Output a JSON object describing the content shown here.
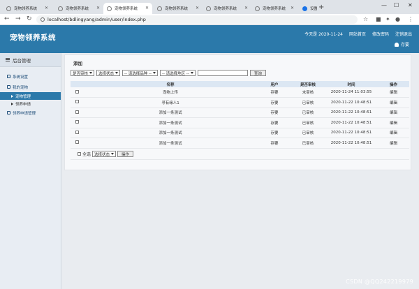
{
  "browser": {
    "tabs": [
      {
        "label": "宠物领养系统",
        "active": false
      },
      {
        "label": "宠物领养系统",
        "active": false
      },
      {
        "label": "宠物领养系统",
        "active": true
      },
      {
        "label": "宠物领养系统",
        "active": false
      },
      {
        "label": "宠物领养系统",
        "active": false
      },
      {
        "label": "宠物领养系统",
        "active": false
      },
      {
        "label": "设置",
        "active": false
      }
    ],
    "url": "localhost/bdlingyang/admin/user/index.php"
  },
  "header": {
    "title": "宠物领养系统",
    "links": [
      "今天是 2020-11-24",
      "网站首页",
      "修改密码",
      "注销退出"
    ],
    "user": "存要"
  },
  "sidebar": {
    "heading": "后台管理",
    "items": [
      {
        "label": "系统设置"
      },
      {
        "label": "我的宠物"
      }
    ],
    "sub_items": [
      {
        "label": "宠物管理",
        "active": true
      },
      {
        "label": "领养申请",
        "active": false
      }
    ],
    "last_item": "领养申请管理"
  },
  "content": {
    "title": "添加",
    "filters": {
      "approval": "是否审核",
      "status": "选择状态",
      "breed": "-- 请选择品种 --",
      "region": "-- 请选择地区 --",
      "search_button": "查询"
    },
    "table": {
      "columns": [
        "名称",
        "用户",
        "是否审核",
        "时间",
        "操作"
      ],
      "rows": [
        {
          "name": "宠物上传",
          "user": "存要",
          "approved": "未审核",
          "time": "2020-11-24 11:03:55",
          "action": "编辑"
        },
        {
          "name": "寻有缘人1",
          "user": "存要",
          "approved": "已审核",
          "time": "2020-11-22 10:48:51",
          "action": "编辑"
        },
        {
          "name": "添加一条测试",
          "user": "存要",
          "approved": "已审核",
          "time": "2020-11-22 10:48:51",
          "action": "编辑"
        },
        {
          "name": "添加一条测试",
          "user": "存要",
          "approved": "已审核",
          "time": "2020-11-22 10:48:51",
          "action": "编辑"
        },
        {
          "name": "添加一条测试",
          "user": "存要",
          "approved": "已审核",
          "time": "2020-11-22 10:48:51",
          "action": "编辑"
        },
        {
          "name": "添加一条测试",
          "user": "存要",
          "approved": "已审核",
          "time": "2020-11-22 10:48:51",
          "action": "编辑"
        }
      ]
    },
    "footer": {
      "select_all": "全选",
      "status": "选择状态",
      "action_button": "操作"
    }
  },
  "watermark": "CSDN @QQ242219979",
  "colors": {
    "header": "#2b79aa",
    "accent_active": "#2b79aa"
  }
}
